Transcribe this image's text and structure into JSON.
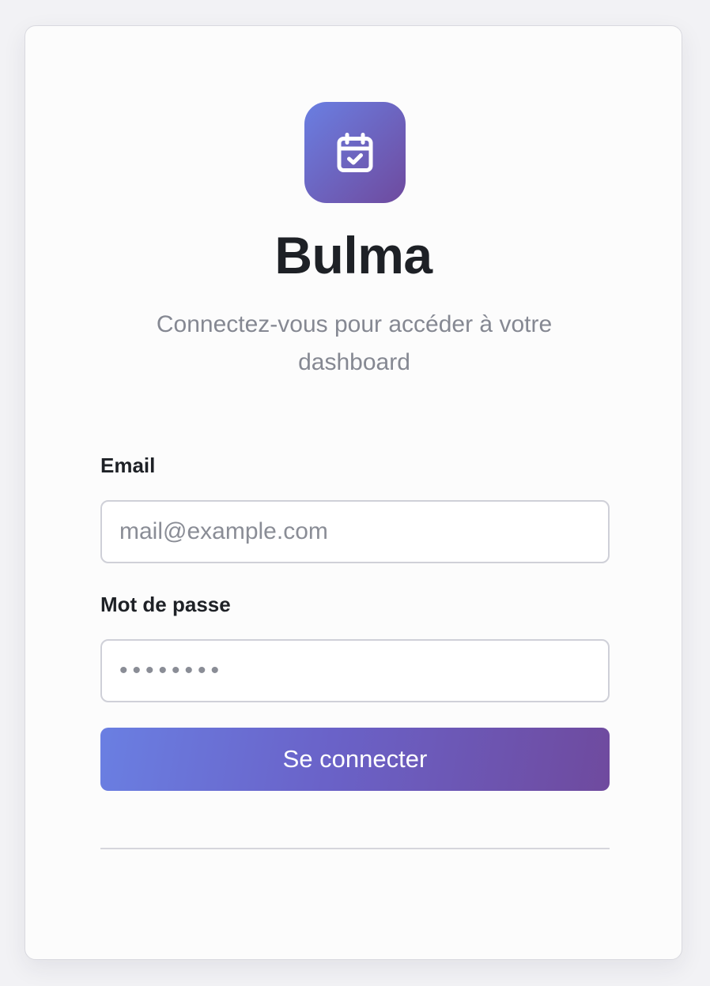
{
  "brand": {
    "name": "Bulma",
    "subtitle": "Connectez-vous pour accéder à votre dashboard",
    "icon": "calendar-check-icon",
    "gradient_start": "#6a7fe2",
    "gradient_end": "#6f4a9e"
  },
  "form": {
    "email_label": "Email",
    "email_placeholder": "mail@example.com",
    "email_value": "",
    "password_label": "Mot de passe",
    "password_placeholder": "••••••••",
    "password_value": "",
    "submit_label": "Se connecter"
  }
}
